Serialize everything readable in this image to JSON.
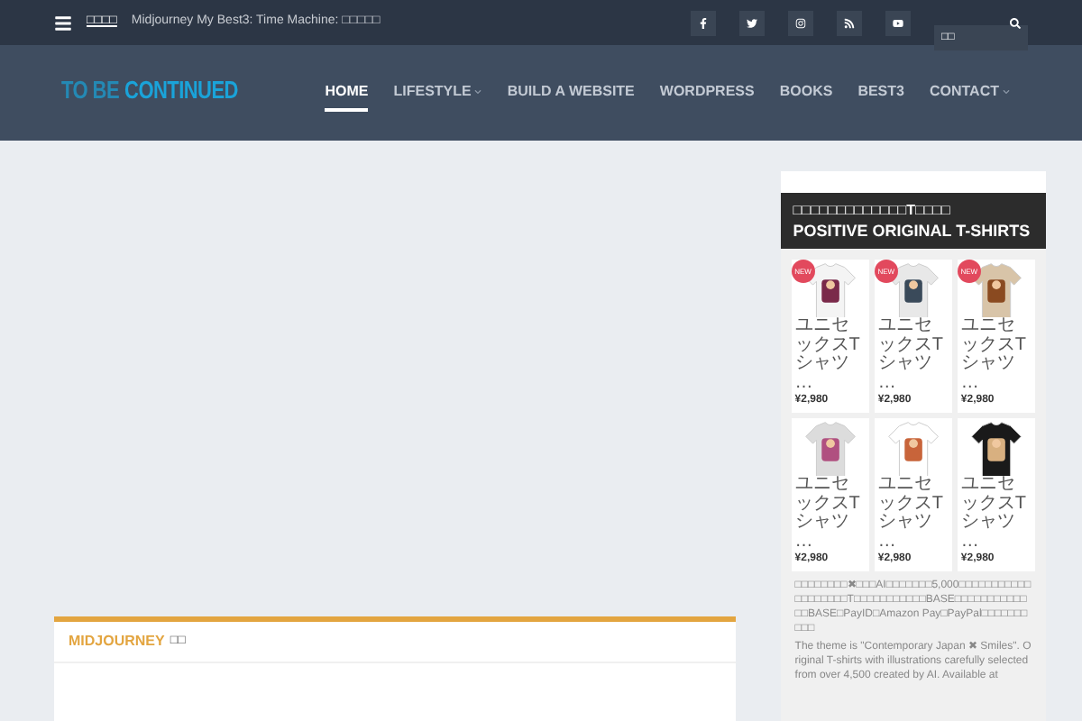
{
  "topbar": {
    "ticker_label": "□□□□",
    "ticker_text": "Midjourney My Best3: Time Machine: □□□□□",
    "social": [
      {
        "kind": "facebook"
      },
      {
        "kind": "twitter"
      },
      {
        "kind": "instagram"
      },
      {
        "kind": "rss"
      },
      {
        "kind": "youtube"
      }
    ],
    "search": {
      "placeholder": "□□"
    }
  },
  "header": {
    "logo_part1": "TO BE",
    "logo_part2": "CONTINUED",
    "nav": [
      {
        "label": "HOME",
        "selected": true,
        "has_menu": false
      },
      {
        "label": "LIFESTYLE",
        "selected": false,
        "has_menu": true
      },
      {
        "label": "BUILD A WEBSITE",
        "selected": false,
        "has_menu": false
      },
      {
        "label": "WORDPRESS",
        "selected": false,
        "has_menu": false
      },
      {
        "label": "BOOKS",
        "selected": false,
        "has_menu": false
      },
      {
        "label": "BEST3",
        "selected": false,
        "has_menu": false
      },
      {
        "label": "CONTACT",
        "selected": false,
        "has_menu": true
      }
    ]
  },
  "main": {
    "section_title": "MIDJOURNEY",
    "section_suffix": "□□"
  },
  "sidebar": {
    "title_line1": "□□□□□□□□□□□□□T□□□□",
    "title_line2": "POSITIVE ORIGINAL T-SHIRTS",
    "products": [
      {
        "name": "ユニセックスTシャツ …",
        "price": "¥2,980",
        "new": true,
        "badge": "NEW"
      },
      {
        "name": "ユニセックスTシャツ …",
        "price": "¥2,980",
        "new": true,
        "badge": "NEW"
      },
      {
        "name": "ユニセックスTシャツ …",
        "price": "¥2,980",
        "new": true,
        "badge": "NEW"
      },
      {
        "name": "ユニセックスTシャツ …",
        "price": "¥2,980",
        "new": false
      },
      {
        "name": "ユニセックスTシャツ …",
        "price": "¥2,980",
        "new": false
      },
      {
        "name": "ユニセックスTシャツ …",
        "price": "¥2,980",
        "new": false
      }
    ],
    "paragraphs": [
      "□□□□□□□□✖□□□AI□□□□□□□5,000□□□□□□□□□□□□□□□□□□□T□□□□□□□□□□□BASE□□□□□□□□□□□□□BASE□PayID□Amazon Pay□PayPal□□□□□□□□□□",
      "The theme is \"Contemporary Japan ✖ Smiles\". Original T-shirts with illustrations carefully selected from over 4,500 created by AI. Available at"
    ]
  }
}
